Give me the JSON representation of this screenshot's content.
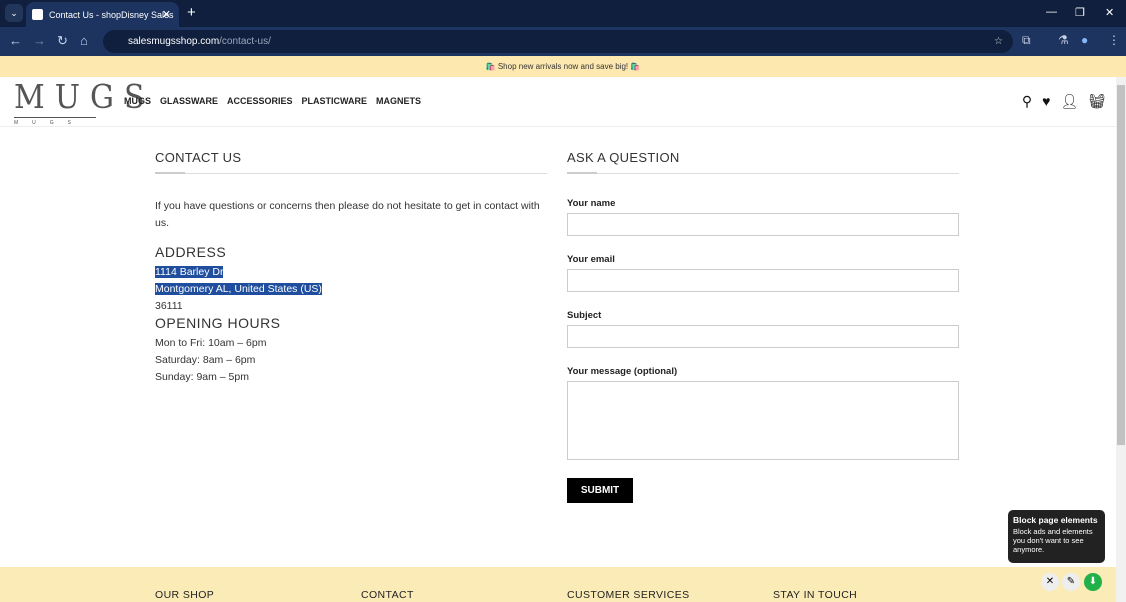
{
  "browser": {
    "tab_title": "Contact Us - shopDisney Sales",
    "url_domain": "salesmugsshop.com",
    "url_path": "/contact-us/"
  },
  "promo": "🛍️ Shop new arrivals now and save big! 🛍️",
  "logo": {
    "big": "MUGS",
    "small": "MUGS"
  },
  "nav": [
    "MUGS",
    "GLASSWARE",
    "ACCESSORIES",
    "PLASTICWARE",
    "MAGNETS"
  ],
  "contact": {
    "title": "CONTACT US",
    "intro": "If you have questions or concerns then please do not hesitate to get in contact with us.",
    "address_title": "ADDRESS",
    "address1": "1114 Barley Dr",
    "address2": "Montgomery AL, United States (US)",
    "zip": "36111",
    "hours_title": "OPENING HOURS",
    "hours": [
      "Mon to Fri: 10am – 6pm",
      "Saturday: 8am – 6pm",
      "Sunday: 9am – 5pm"
    ]
  },
  "form": {
    "title": "ASK A QUESTION",
    "name": "Your name",
    "email": "Your email",
    "subject": "Subject",
    "message": "Your message (optional)",
    "submit": "SUBMIT"
  },
  "footer": [
    "OUR SHOP",
    "CONTACT",
    "CUSTOMER SERVICES",
    "STAY IN TOUCH"
  ],
  "tooltip": {
    "title": "Block page elements",
    "body": "Block ads and elements you don't want to see anymore."
  }
}
